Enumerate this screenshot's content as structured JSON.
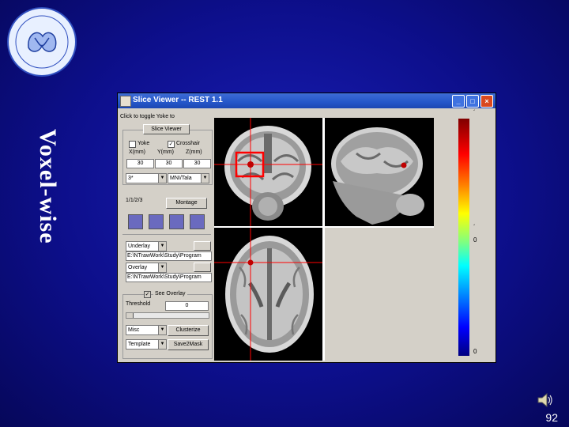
{
  "slide": {
    "title": "Voxel-wise",
    "page_number": "92"
  },
  "window": {
    "title": "Slice Viewer -- REST 1.1",
    "controls": [
      "_",
      "□",
      "×"
    ]
  },
  "panel": {
    "hint": "Click to toggle Yoke to",
    "group_title": "Slice Viewer",
    "yoke_label": "Yoke",
    "crosshair_label": "Crosshair",
    "yoke_checked": false,
    "crosshair_checked": true,
    "coord_labels": [
      "X(mm)",
      "Y(mm)",
      "Z(mm)"
    ],
    "coords": [
      "30",
      "30",
      "30"
    ],
    "orient_value": "3*",
    "space_value": "MNI/Tala",
    "display_label": "1/1/2/3",
    "montage_label": "Montage",
    "underlay_label": "Underlay",
    "underlay_path": "E:\\NTrawWork\\Study\\Program",
    "overlay_label": "Overlay",
    "overlay_path": "E:\\NTrawWork\\Study\\Program",
    "see_overlay_label": "See Overlay",
    "see_overlay_checked": true,
    "threshold_label": "Threshold",
    "threshold_value": "0",
    "misc_value": "Misc",
    "clusterize_label": "Clusterize",
    "template_value": "Template",
    "save2mask_label": "Save2Mask"
  },
  "colorbar": {
    "top_tick": "´",
    "mid_tick": "´",
    "zero_top": "0",
    "zero_bottom": "0"
  },
  "icons": {
    "logo": "university-logo",
    "speaker": "speaker-icon"
  },
  "colors": {
    "background": "#0d0f8c",
    "crosshair": "#ff0000",
    "marker": "#c00000"
  }
}
